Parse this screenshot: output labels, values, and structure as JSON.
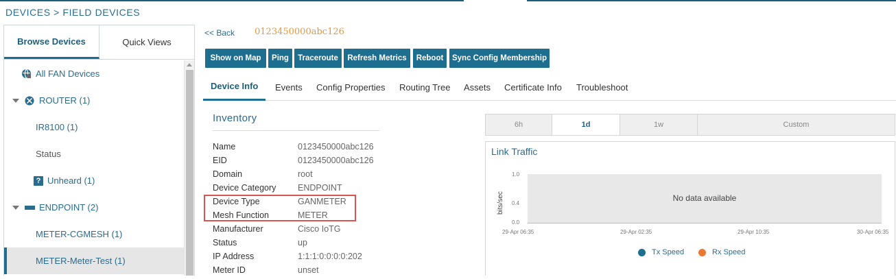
{
  "breadcrumb": "DEVICES > FIELD DEVICES",
  "sidebar": {
    "tabs": [
      "Browse Devices",
      "Quick Views"
    ],
    "items": [
      {
        "label": "All FAN Devices"
      },
      {
        "label": "ROUTER (1)"
      },
      {
        "label": "IR8100 (1)"
      },
      {
        "label": "Status"
      },
      {
        "label": "Unheard (1)"
      },
      {
        "label": "ENDPOINT (2)"
      },
      {
        "label": "METER-CGMESH (1)"
      },
      {
        "label": "METER-Meter-Test (1)"
      }
    ],
    "unheard_icon": "?"
  },
  "header": {
    "back_label": "<< Back",
    "device_title": "0123450000abc126"
  },
  "actions": [
    "Show on Map",
    "Ping",
    "Traceroute",
    "Refresh Metrics",
    "Reboot",
    "Sync Config Membership"
  ],
  "tabs": [
    "Device Info",
    "Events",
    "Config Properties",
    "Routing Tree",
    "Assets",
    "Certificate Info",
    "Troubleshoot"
  ],
  "inventory": {
    "title": "Inventory",
    "rows": [
      {
        "key": "Name",
        "value": "0123450000abc126"
      },
      {
        "key": "EID",
        "value": "0123450000abc126"
      },
      {
        "key": "Domain",
        "value": "root"
      },
      {
        "key": "Device Category",
        "value": "ENDPOINT"
      },
      {
        "key": "Device Type",
        "value": "GANMETER"
      },
      {
        "key": "Mesh Function",
        "value": "METER"
      },
      {
        "key": "Manufacturer",
        "value": "Cisco IoTG"
      },
      {
        "key": "Status",
        "value": "up"
      },
      {
        "key": "IP Address",
        "value": "1:1:1:0:0:0:0:202"
      },
      {
        "key": "Meter ID",
        "value": "unset"
      }
    ]
  },
  "time_ranges": {
    "options": [
      "6h",
      "1d",
      "1w",
      "Custom"
    ],
    "selected": "1d"
  },
  "link_traffic": {
    "title": "Link Traffic",
    "no_data": "No data available"
  },
  "chart_data": {
    "type": "line",
    "title": "Link Traffic",
    "ylabel": "bits/sec",
    "yticks": [
      "1.0",
      "0.4",
      "0.0"
    ],
    "xticks": [
      "29-Apr 06:35",
      "29-Apr 02:35",
      "29-Apr 10:35",
      "30-Apr 06:35"
    ],
    "ylim": [
      0,
      1
    ],
    "series": [
      {
        "name": "Tx Speed",
        "color": "#1d6e8f",
        "values": []
      },
      {
        "name": "Rx Speed",
        "color": "#e87a35",
        "values": []
      }
    ],
    "legend": "bottom"
  },
  "colors": {
    "accent": "#1d6e8f",
    "title_orange": "#e8973a",
    "highlight": "#d9534f"
  }
}
